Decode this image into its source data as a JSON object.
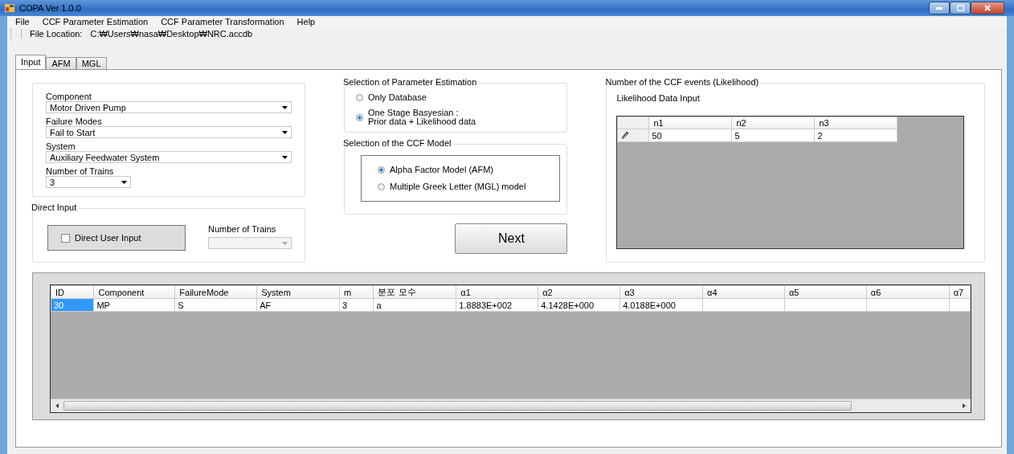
{
  "window": {
    "title": "COPA Ver 1.0.0"
  },
  "menu": [
    "File",
    "CCF Parameter Estimation",
    "CCF Parameter Transformation",
    "Help"
  ],
  "toolbar": {
    "label": "File Location:",
    "path": "C:₩Users₩nasa₩Desktop₩NRC.accdb"
  },
  "tabs": [
    {
      "label": "Input",
      "selected": true
    },
    {
      "label": "AFM",
      "selected": false
    },
    {
      "label": "MGL",
      "selected": false
    }
  ],
  "selection_fields": [
    {
      "label": "Component",
      "value": "Motor Driven Pump",
      "kind": "wide"
    },
    {
      "label": "Failure Modes",
      "value": "Fail to Start",
      "kind": "wide"
    },
    {
      "label": "System",
      "value": "Auxiliary Feedwater System",
      "kind": "wide"
    },
    {
      "label": "Number of Trains",
      "value": "3",
      "kind": "narrow"
    }
  ],
  "direct_input": {
    "title": "Direct Input",
    "checkbox_label": "Direct User Input",
    "checked": false,
    "trains_label": "Number of Trains",
    "trains_disabled": true
  },
  "parameter_estimation": {
    "title": "Selection of Parameter Estimation",
    "options": [
      {
        "label": "Only Database",
        "selected": false
      },
      {
        "label": "One Stage Basyesian :\nPrior data + Likelihood data",
        "selected": true
      }
    ]
  },
  "ccf_model": {
    "title": "Selection of the CCF Model",
    "options": [
      {
        "label": "Alpha Factor Model (AFM)",
        "selected": true
      },
      {
        "label": "Multiple Greek Letter (MGL) model",
        "selected": false
      }
    ]
  },
  "next_button": "Next",
  "likelihood": {
    "title": "Number of the CCF events (Likelihood)",
    "subtitle": "Likelihood Data Input",
    "columns": [
      "n1",
      "n2",
      "n3"
    ],
    "rows": [
      [
        "50",
        "5",
        "2"
      ]
    ]
  },
  "results": {
    "columns": [
      "ID",
      "Component",
      "FailureMode",
      "System",
      "m",
      "분포 모수",
      "α1",
      "α2",
      "α3",
      "α4",
      "α5",
      "α6",
      "α7"
    ],
    "rows": [
      {
        "cells": [
          {
            "text": "30",
            "selected": true
          },
          {
            "text": "MP",
            "selected": false
          },
          {
            "text": "S",
            "selected": false
          },
          {
            "text": "AF",
            "selected": false
          },
          {
            "text": "3",
            "selected": false
          },
          {
            "text": "a",
            "selected": false
          },
          {
            "text": "1.8883E+002",
            "selected": false
          },
          {
            "text": "4.1428E+000",
            "selected": false
          },
          {
            "text": "4.0188E+000",
            "selected": false
          }
        ]
      }
    ]
  }
}
